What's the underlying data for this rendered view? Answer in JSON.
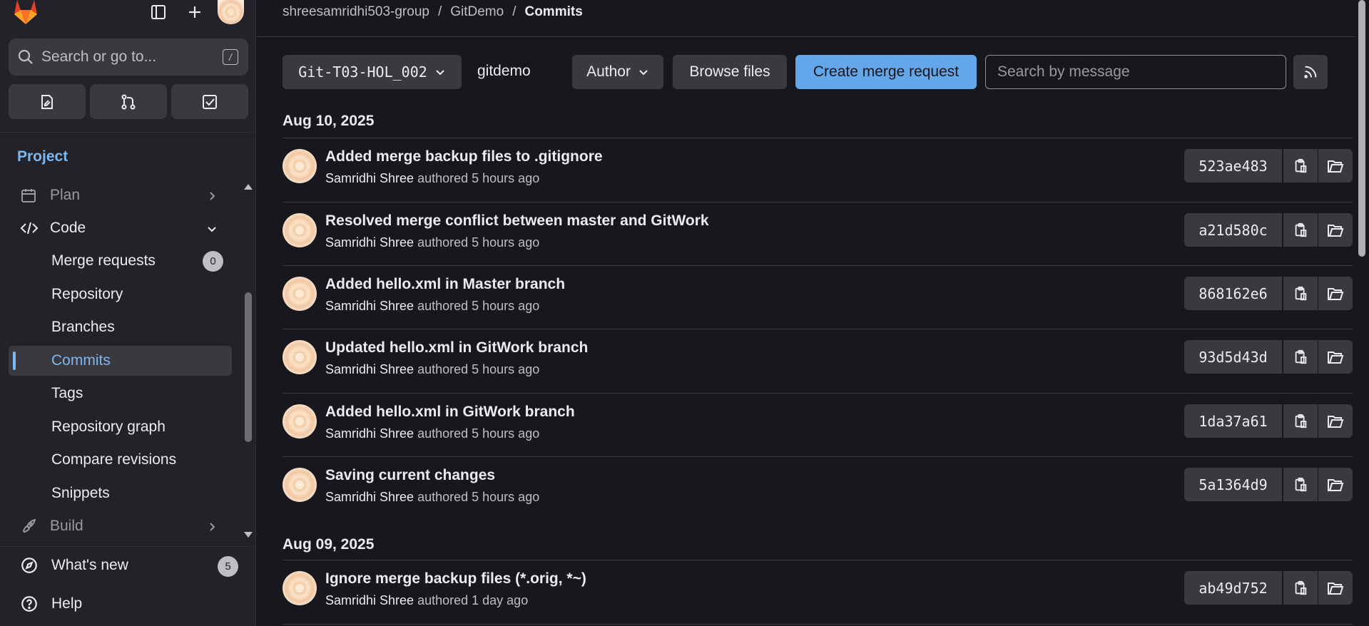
{
  "sidebar": {
    "search_placeholder": "Search or go to...",
    "search_shortcut": "/",
    "section": "Project",
    "items": [
      {
        "label": "Plan"
      },
      {
        "label": "Code"
      },
      {
        "label": "Merge requests",
        "count": "0"
      },
      {
        "label": "Repository"
      },
      {
        "label": "Branches"
      },
      {
        "label": "Commits"
      },
      {
        "label": "Tags"
      },
      {
        "label": "Repository graph"
      },
      {
        "label": "Compare revisions"
      },
      {
        "label": "Snippets"
      },
      {
        "label": "Build"
      }
    ],
    "whats_new": "What's new",
    "whats_new_count": "5",
    "help": "Help"
  },
  "breadcrumb": {
    "group": "shreesamridhi503-group",
    "project": "GitDemo",
    "current": "Commits"
  },
  "toolbar": {
    "branch": "Git-T03-HOL_002",
    "path": "gitdemo",
    "author": "Author",
    "browse": "Browse files",
    "create_mr": "Create merge request",
    "search_placeholder": "Search by message"
  },
  "groups": [
    {
      "date": "Aug 10, 2025",
      "commits": [
        {
          "title": "Added merge backup files to .gitignore",
          "author": "Samridhi Shree",
          "meta": "authored 5 hours ago",
          "sha": "523ae483"
        },
        {
          "title": "Resolved merge conflict between master and GitWork",
          "author": "Samridhi Shree",
          "meta": "authored 5 hours ago",
          "sha": "a21d580c"
        },
        {
          "title": "Added hello.xml in Master branch",
          "author": "Samridhi Shree",
          "meta": "authored 5 hours ago",
          "sha": "868162e6"
        },
        {
          "title": "Updated hello.xml in GitWork branch",
          "author": "Samridhi Shree",
          "meta": "authored 5 hours ago",
          "sha": "93d5d43d"
        },
        {
          "title": "Added hello.xml in GitWork branch",
          "author": "Samridhi Shree",
          "meta": "authored 5 hours ago",
          "sha": "1da37a61"
        },
        {
          "title": "Saving current changes",
          "author": "Samridhi Shree",
          "meta": "authored 5 hours ago",
          "sha": "5a1364d9"
        }
      ]
    },
    {
      "date": "Aug 09, 2025",
      "commits": [
        {
          "title": "Ignore merge backup files (*.orig, *~)",
          "author": "Samridhi Shree",
          "meta": "authored 1 day ago",
          "sha": "ab49d752"
        }
      ]
    }
  ],
  "colors": {
    "accent": "#63a6e9",
    "link": "#7cb7f0",
    "bg": "#18171d",
    "sidebar": "#232228"
  }
}
